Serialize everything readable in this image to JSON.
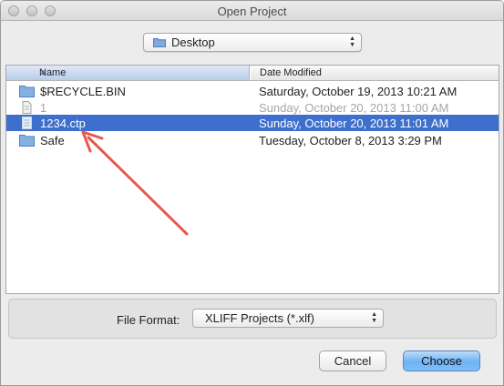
{
  "window": {
    "title": "Open Project",
    "controls": [
      "close-button",
      "minimize-button",
      "zoom-button"
    ]
  },
  "location": {
    "selected": "Desktop",
    "icon": "folder-icon"
  },
  "table": {
    "columns": [
      {
        "label": "Name",
        "sorted": "ascending"
      },
      {
        "label": "Date Modified"
      }
    ],
    "rows": [
      {
        "name": "$RECYCLE.BIN",
        "date": "Saturday, October 19, 2013 10:21 AM",
        "icon": "folder-icon",
        "state": "normal"
      },
      {
        "name": "1",
        "date": "Sunday, October 20, 2013 11:00 AM",
        "icon": "document-icon",
        "state": "disabled"
      },
      {
        "name": "1234.ctp",
        "date": "Sunday, October 20, 2013 11:01 AM",
        "icon": "document-icon",
        "state": "selected"
      },
      {
        "name": "Safe",
        "date": "Tuesday, October 8, 2013 3:29 PM",
        "icon": "folder-icon",
        "state": "normal"
      }
    ]
  },
  "format": {
    "label": "File Format:",
    "selected": "XLIFF Projects (*.xlf)"
  },
  "buttons": {
    "cancel": "Cancel",
    "choose": "Choose"
  },
  "colors": {
    "selection": "#3e6fcd",
    "default_button": "#6fb1f2",
    "annotation_arrow": "#e9594a"
  }
}
